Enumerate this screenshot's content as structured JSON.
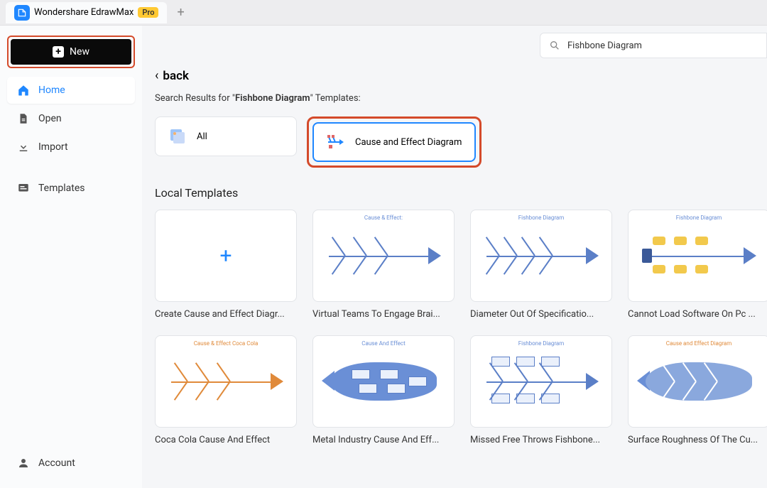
{
  "app": {
    "name": "Wondershare EdrawMax",
    "badge": "Pro"
  },
  "sidebar": {
    "new_label": "New",
    "items": [
      {
        "label": "Home"
      },
      {
        "label": "Open"
      },
      {
        "label": "Import"
      },
      {
        "label": "Templates"
      },
      {
        "label": "Account"
      }
    ]
  },
  "search": {
    "value": "Fishbone Diagram"
  },
  "back": {
    "label": "back"
  },
  "results": {
    "prefix": "Search Results for \"",
    "term": "Fishbone Diagram",
    "suffix": "\" Templates:"
  },
  "filters": [
    {
      "label": "All"
    },
    {
      "label": "Cause and Effect Diagram"
    }
  ],
  "section": {
    "local_title": "Local Templates"
  },
  "templates": [
    {
      "label": "Create Cause and Effect Diagr..."
    },
    {
      "label": "Virtual Teams To Engage Brai..."
    },
    {
      "label": "Diameter Out Of Specificatio..."
    },
    {
      "label": "Cannot Load Software On Pc ..."
    },
    {
      "label": "Coca Cola Cause And Effect"
    },
    {
      "label": "Metal Industry Cause And Eff..."
    },
    {
      "label": "Missed Free Throws Fishbone..."
    },
    {
      "label": "Surface Roughness Of The Cu..."
    }
  ],
  "thumb_titles": {
    "t1": "Cause & Effect:",
    "t2": "Fishbone Diagram",
    "t3": "Cause & Effect Coca Cola",
    "t4": "Cause And Effect",
    "t5": "Fishbone Diagram",
    "t6": "Cause and Effect Diagram"
  }
}
